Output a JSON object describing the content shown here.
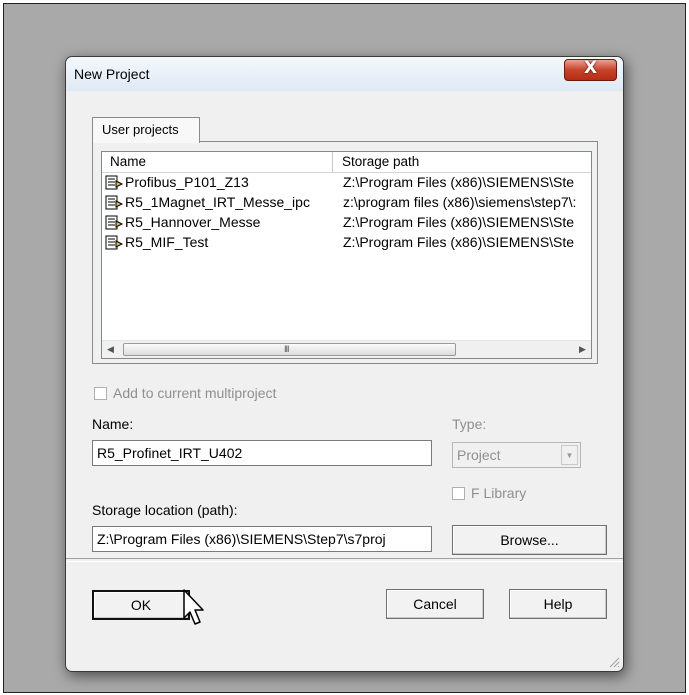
{
  "dialog": {
    "title": "New Project",
    "close_label": "X"
  },
  "tabs": [
    {
      "label": "User projects"
    }
  ],
  "project_list": {
    "columns": [
      "Name",
      "Storage path"
    ],
    "rows": [
      {
        "name": "Profibus_P101_Z13",
        "path": "Z:\\Program Files (x86)\\SIEMENS\\Ste"
      },
      {
        "name": "R5_1Magnet_IRT_Messe_ipc",
        "path": "z:\\program files (x86)\\siemens\\step7\\:"
      },
      {
        "name": "R5_Hannover_Messe",
        "path": "Z:\\Program Files (x86)\\SIEMENS\\Ste"
      },
      {
        "name": "R5_MIF_Test",
        "path": "Z:\\Program Files (x86)\\SIEMENS\\Ste"
      }
    ],
    "scroll_grip": "III"
  },
  "multiproject": {
    "label": "Add to current multiproject",
    "checked": false
  },
  "name_field": {
    "label": "Name:",
    "value": "R5_Profinet_IRT_U402"
  },
  "type_field": {
    "label": "Type:",
    "value": "Project"
  },
  "f_library": {
    "label": "F Library",
    "checked": false
  },
  "storage": {
    "label": "Storage location (path):",
    "value": "Z:\\Program Files (x86)\\SIEMENS\\Step7\\s7proj"
  },
  "buttons": {
    "browse": "Browse...",
    "ok": "OK",
    "cancel": "Cancel",
    "help": "Help"
  },
  "colors": {
    "close_button": "#c7432a",
    "window_bg": "#f0f0f0",
    "backdrop": "#a9a9a9"
  }
}
